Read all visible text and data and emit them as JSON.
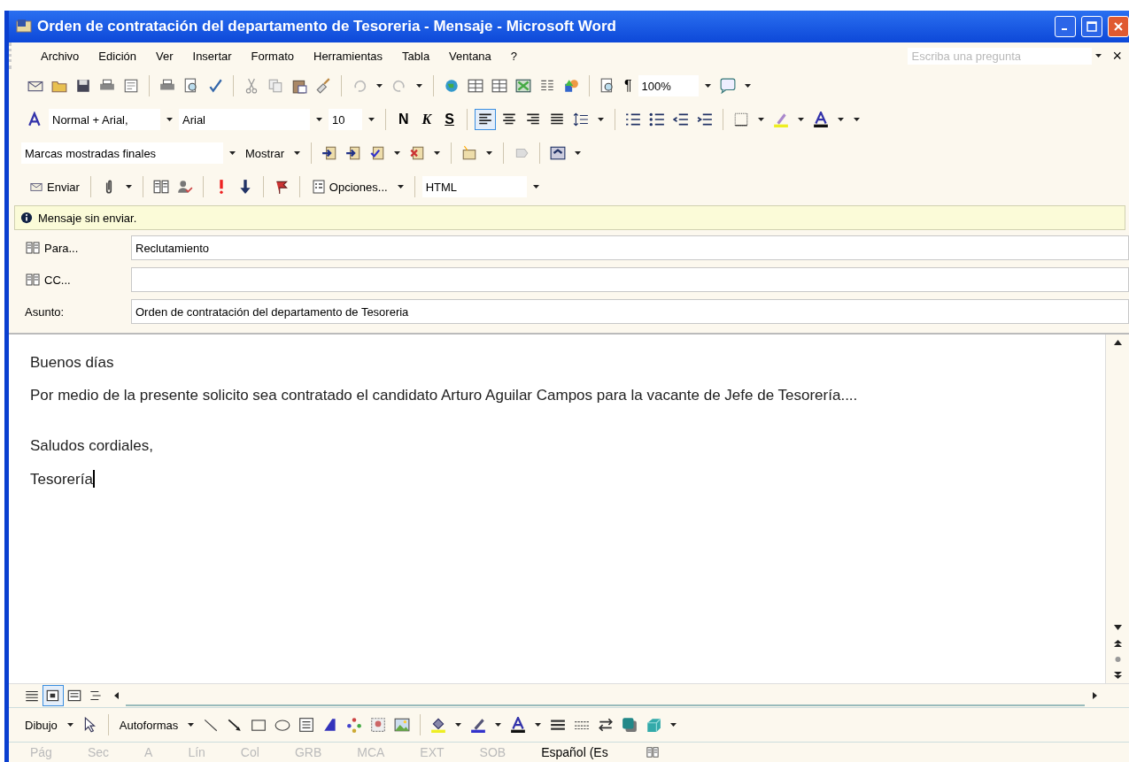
{
  "window": {
    "title": "Orden de contratación del departamento de Tesoreria - Mensaje - Microsoft Word"
  },
  "menu": {
    "items": [
      "Archivo",
      "Edición",
      "Ver",
      "Insertar",
      "Formato",
      "Herramientas",
      "Tabla",
      "Ventana",
      "?"
    ],
    "help_box": {
      "placeholder": "Escriba una pregunta"
    },
    "close": "×"
  },
  "standard_toolbar": {
    "pilcrow": "¶",
    "zoom": "100%"
  },
  "formatting_toolbar": {
    "style": "Normal + Arial,",
    "font": "Arial",
    "size": "10",
    "bold": "N",
    "italic": "K",
    "underline": "S",
    "alignment": [
      {
        "selected": true
      },
      {
        "selected": false
      },
      {
        "selected": false
      },
      {
        "selected": false
      }
    ]
  },
  "reviewing_toolbar": {
    "display": "Marcas mostradas finales",
    "show": "Mostrar"
  },
  "email_toolbar": {
    "send": "Enviar",
    "options": "Opciones...",
    "format": "HTML"
  },
  "info_bar": {
    "text": "Mensaje sin enviar."
  },
  "fields": [
    {
      "kind": "address",
      "label": "Para...",
      "value": "Reclutamiento"
    },
    {
      "kind": "address",
      "label": "CC..."
    },
    {
      "kind": "subject",
      "label": "Asunto:",
      "value": "Orden de contratación del departamento de Tesoreria"
    }
  ],
  "body": {
    "sections": [
      [
        "Buenos días",
        "Por medio de la presente solicito sea contratado el candidato Arturo Aguilar Campos para la vacante de Jefe de Tesorería...."
      ],
      [
        "Saludos cordiales,",
        "Tesorería"
      ]
    ]
  },
  "view_buttons": [
    {
      "selected": false
    },
    {
      "selected": true
    },
    {
      "selected": false
    },
    {
      "selected": false
    }
  ],
  "drawing_toolbar": {
    "draw": "Dibujo",
    "autoshapes": "Autoformas"
  },
  "status_bar": [
    {
      "text": "Pág",
      "disabled": true
    },
    {
      "text": "Sec",
      "disabled": true
    },
    {
      "text": "A",
      "disabled": true
    },
    {
      "text": "Lín",
      "disabled": true
    },
    {
      "text": "Col",
      "disabled": true
    },
    {
      "text": "GRB",
      "disabled": true
    },
    {
      "text": "MCA",
      "disabled": true
    },
    {
      "text": "EXT",
      "disabled": true
    },
    {
      "text": "SOB",
      "disabled": true
    },
    {
      "text": "Español (Es",
      "disabled": false
    }
  ]
}
